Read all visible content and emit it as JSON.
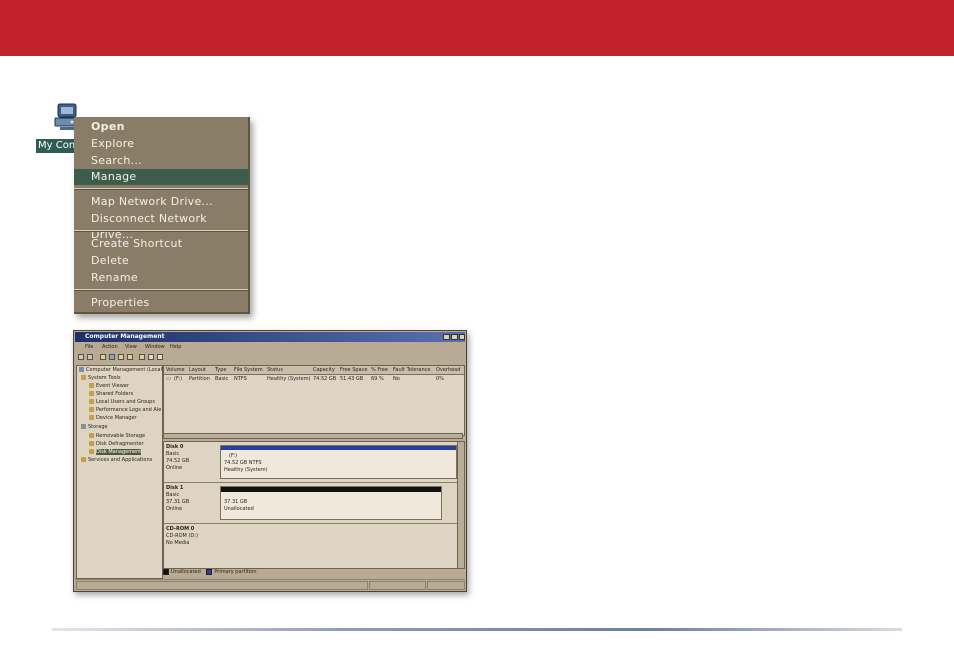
{
  "desktop": {
    "icon": "my-computer-icon",
    "label": "My Computer"
  },
  "context_menu": {
    "items": [
      {
        "label": "Open"
      },
      {
        "label": "Explore"
      },
      {
        "label": "Search..."
      },
      {
        "label": "Manage"
      },
      {
        "label": "Map Network Drive..."
      },
      {
        "label": "Disconnect Network Drive..."
      },
      {
        "label": "Create Shortcut"
      },
      {
        "label": "Delete"
      },
      {
        "label": "Rename"
      },
      {
        "label": "Properties"
      }
    ]
  },
  "window": {
    "title": "Computer Management",
    "menu": [
      "File",
      "Action",
      "View",
      "Window",
      "Help"
    ],
    "tree": [
      {
        "label": "Computer Management (Local)"
      },
      {
        "label": "System Tools"
      },
      {
        "label": "Event Viewer"
      },
      {
        "label": "Shared Folders"
      },
      {
        "label": "Local Users and Groups"
      },
      {
        "label": "Performance Logs and Ale"
      },
      {
        "label": "Device Manager"
      },
      {
        "label": "Storage"
      },
      {
        "label": "Removable Storage"
      },
      {
        "label": "Disk Defragmenter"
      },
      {
        "label": "Disk Management"
      },
      {
        "label": "Services and Applications"
      }
    ],
    "volume_columns": [
      "Volume",
      "Layout",
      "Type",
      "File System",
      "Status",
      "Capacity",
      "Free Space",
      "% Free",
      "Fault Tolerance",
      "Overhead"
    ],
    "volume_row": [
      "(F:)",
      "Partition",
      "Basic",
      "NTFS",
      "Healthy (System)",
      "74.52 GB",
      "51.43 GB",
      "69 %",
      "No",
      "0%"
    ],
    "disks": [
      {
        "name": "Disk 0",
        "type": "Basic",
        "size": "74.52 GB",
        "status": "Online",
        "part_lines": [
          "(F:)",
          "74.52 GB NTFS",
          "Healthy (System)"
        ]
      },
      {
        "name": "Disk 1",
        "type": "Basic",
        "size": "37.31 GB",
        "status": "Online",
        "part_lines": [
          "37.31 GB",
          "Unallocated"
        ]
      },
      {
        "name": "CD-ROM 0",
        "type": "CD-ROM (D:)",
        "size": "",
        "status": "No Media"
      }
    ],
    "legend": {
      "unallocated": "Unallocated",
      "primary": "Primary partition"
    },
    "colors": {
      "unallocated": "#111111",
      "primary": "#2b3f9e"
    }
  }
}
